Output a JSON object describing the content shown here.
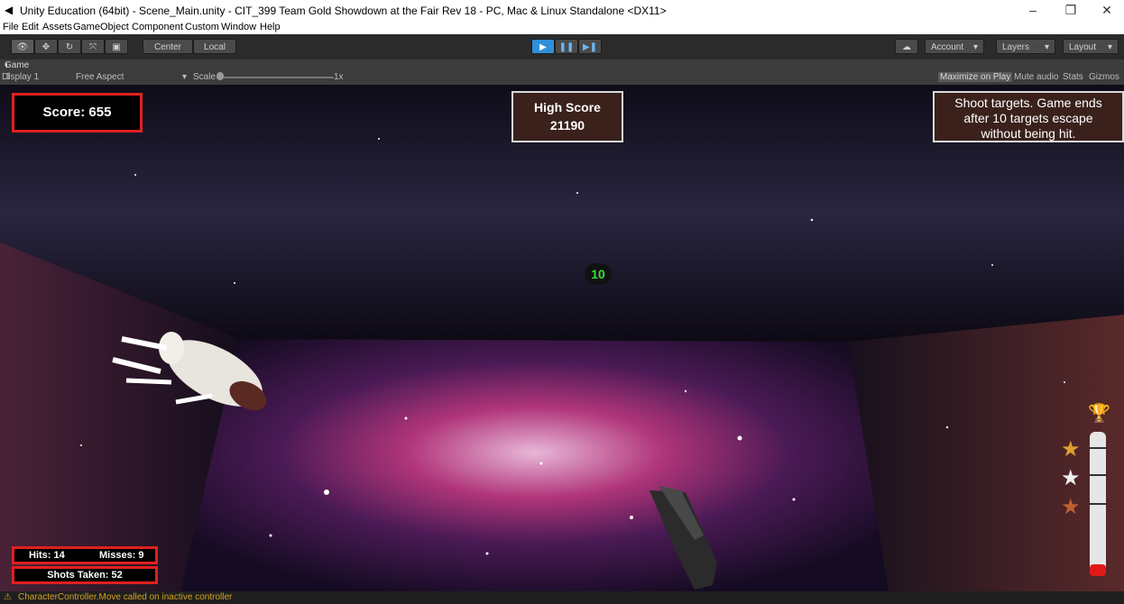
{
  "window": {
    "title": "Unity Education (64bit) - Scene_Main.unity - CIT_399 Team Gold Showdown at the Fair Rev 18 - PC, Mac & Linux Standalone <DX11>",
    "minimize": "–",
    "maximize": "❐",
    "close": "✕"
  },
  "menu": [
    "File",
    "Edit",
    "Assets",
    "GameObject",
    "Component",
    "Custom",
    "Window",
    "Help"
  ],
  "toolbar": {
    "pivot": "Center",
    "space": "Local",
    "account": "Account",
    "layers": "Layers",
    "layout": "Layout"
  },
  "game_tab": {
    "tab_label": "Game",
    "display": "Display 1",
    "aspect": "Free Aspect",
    "scale_label": "Scale",
    "scale_value": "1x",
    "maximize_on_play": "Maximize on Play",
    "mute_audio": "Mute audio",
    "stats": "Stats",
    "gizmos": "Gizmos"
  },
  "hud": {
    "score": "Score: 655",
    "high_score_label": "High Score",
    "high_score_value": "21190",
    "instructions_line1": "Shoot targets. Game ends",
    "instructions_line2": "after 10 targets escape",
    "instructions_line3": "without being hit.",
    "countdown": "10",
    "hits": "Hits: 14",
    "misses": "Misses: 9",
    "shots_taken": "Shots Taken: 52"
  },
  "status": {
    "message": "CharacterController.Move called on inactive controller"
  },
  "colors": {
    "hud_border": "#e02020",
    "panel_bg": "#3a211c",
    "play_blue": "#2f8fd8",
    "countdown_green": "#38e038"
  }
}
